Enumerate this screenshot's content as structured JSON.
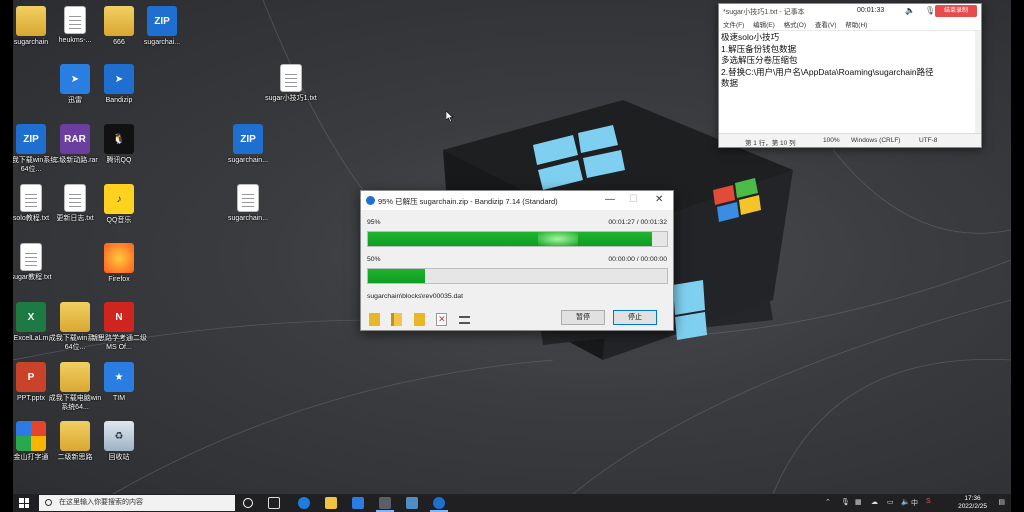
{
  "desktop_icons": [
    {
      "label": "sugarchain",
      "icon": "folder-icon"
    },
    {
      "label": "heukms-...",
      "icon": "document-icon"
    },
    {
      "label": "666",
      "icon": "folder-icon"
    },
    {
      "label": "sugarchai...",
      "icon": "zip-icon"
    },
    {
      "label": "迅雷",
      "icon": "thunder-icon"
    },
    {
      "label": "Bandizip",
      "icon": "bandizip-icon"
    },
    {
      "label": "sugar小技巧1.txt",
      "icon": "text-file-icon"
    },
    {
      "label": "成我下载win系统64位...",
      "icon": "zip-icon"
    },
    {
      "label": "二级新动路.rar",
      "icon": "rar-icon"
    },
    {
      "label": "腾讯QQ",
      "icon": "qq-icon"
    },
    {
      "label": "sugarchain...",
      "icon": "zip-icon"
    },
    {
      "label": "solo教程.txt",
      "icon": "text-file-icon"
    },
    {
      "label": "更新日志.txt",
      "icon": "text-file-icon"
    },
    {
      "label": "QQ音乐",
      "icon": "music-icon"
    },
    {
      "label": "sugarchain...",
      "icon": "document-icon"
    },
    {
      "label": "sugar教程.txt",
      "icon": "text-file-icon"
    },
    {
      "label": "Firefox",
      "icon": "firefox-icon"
    },
    {
      "label": "ExcelLaLm",
      "icon": "excel-icon"
    },
    {
      "label": "成我下载win系统64位...",
      "icon": "folder-icon"
    },
    {
      "label": "新思路学考通二级MS Of...",
      "icon": "app-icon"
    },
    {
      "label": "PPT.pptx",
      "icon": "powerpoint-icon"
    },
    {
      "label": "成我下载电脑win系统64...",
      "icon": "folder-icon"
    },
    {
      "label": "TIM",
      "icon": "tim-icon"
    },
    {
      "label": "金山打字通",
      "icon": "typing-icon"
    },
    {
      "label": "二级新思路",
      "icon": "folder-icon"
    },
    {
      "label": "回收站",
      "icon": "recycle-bin-icon"
    }
  ],
  "notepad": {
    "title": "*sugar小技巧1.txt - 记事本",
    "timer": "00:01:33",
    "end_button": "结束录制",
    "menu": [
      "文件(F)",
      "编辑(E)",
      "格式(O)",
      "查看(V)",
      "帮助(H)"
    ],
    "lines": [
      "极速solo小技巧",
      "1.解压备份钱包数据",
      "多选解压分卷压缩包",
      "2.替换C:\\用户\\用户名\\AppData\\Roaming\\sugarchain路径",
      "数据"
    ],
    "status": {
      "position": "第 1 行，第 10 列",
      "zoom": "100%",
      "line_ending": "Windows (CRLF)",
      "encoding": "UTF-8"
    }
  },
  "bandizip": {
    "title": "95% 已解压 sugarchain.zip - Bandizip 7.14 (Standard)",
    "total": {
      "percent_label": "95%",
      "time": "00:01:27 / 00:01:32",
      "progress": 0.95
    },
    "file": {
      "percent_label": "50%",
      "time": "00:00:00 / 00:00:00",
      "progress": 0.19
    },
    "current_file": "sugarchain\\blocks\\rev00035.dat",
    "pause_label": "暂停",
    "stop_label": "停止"
  },
  "taskbar": {
    "search_placeholder": "在这里输入你要搜索的内容",
    "ime": "中",
    "time": "17:36",
    "date": "2022/2/25"
  }
}
